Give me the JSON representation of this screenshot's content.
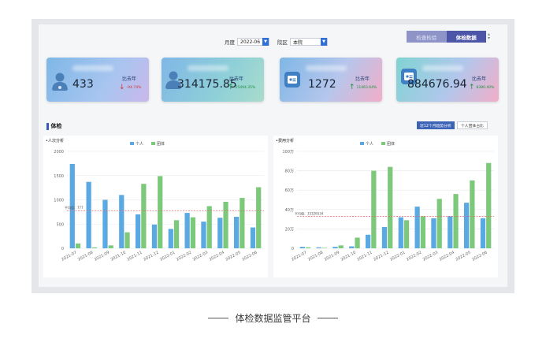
{
  "filters": {
    "month_label": "月度",
    "month_value": "2022-06",
    "region_label": "院区",
    "region_value": "本院"
  },
  "toggle": {
    "option1": "检查检验",
    "option2": "体检数据"
  },
  "cards": [
    {
      "value": "433",
      "compare_label": "比去年",
      "change": "-94.74%",
      "direction": "down"
    },
    {
      "value": "314175.85",
      "compare_label": "比去年",
      "change": "25494.35%",
      "direction": "up"
    },
    {
      "value": "1272",
      "compare_label": "比去年",
      "change": "11463.64%",
      "direction": "up"
    },
    {
      "value": "884676.94",
      "compare_label": "比去年",
      "change": "8380.40%",
      "direction": "up"
    }
  ],
  "section": {
    "title": "体检",
    "btn_trend": "近12个月趋势分析",
    "btn_ratio": "个人团体占比"
  },
  "colors": {
    "personal": "#5aa9e3",
    "group": "#7cc97c",
    "avg_line": "#e06b6b"
  },
  "chart_data": [
    {
      "type": "bar",
      "title": "•人次分析",
      "categories": [
        "2021-07",
        "2021-08",
        "2021-09",
        "2021-10",
        "2021-11",
        "2021-12",
        "2022-01",
        "2022-02",
        "2022-03",
        "2022-04",
        "2022-05",
        "2022-06"
      ],
      "series": [
        {
          "name": "个人",
          "values": [
            1740,
            1370,
            1000,
            1100,
            700,
            490,
            400,
            730,
            550,
            630,
            650,
            430
          ]
        },
        {
          "name": "团体",
          "values": [
            100,
            20,
            60,
            330,
            1330,
            1490,
            580,
            640,
            870,
            960,
            1040,
            1260
          ]
        }
      ],
      "yticks": [
        "0",
        "500",
        "1000",
        "1500",
        "2000"
      ],
      "ylim": [
        0,
        2000
      ],
      "avg_label": "平均值：777",
      "avg": 777
    },
    {
      "type": "bar",
      "title": "•费用分析",
      "categories": [
        "2021-07",
        "2021-08",
        "2021-09",
        "2021-10",
        "2021-11",
        "2021-12",
        "2022-01",
        "2022-02",
        "2022-03",
        "2022-04",
        "2022-05",
        "2022-06"
      ],
      "series": [
        {
          "name": "个人",
          "values": [
            1.5,
            1.0,
            1.5,
            2.0,
            14,
            22,
            32,
            43,
            31,
            33,
            47,
            31
          ]
        },
        {
          "name": "团体",
          "values": [
            1.0,
            0.5,
            3.0,
            11,
            80,
            84,
            29,
            33,
            51,
            56,
            70,
            88
          ]
        }
      ],
      "yticks": [
        "0",
        "20万",
        "40万",
        "60万",
        "80万",
        "100万"
      ],
      "ylim": [
        0,
        100
      ],
      "avg_label": "平均值：33326534",
      "avg": 33
    }
  ],
  "caption": "体检数据监管平台"
}
